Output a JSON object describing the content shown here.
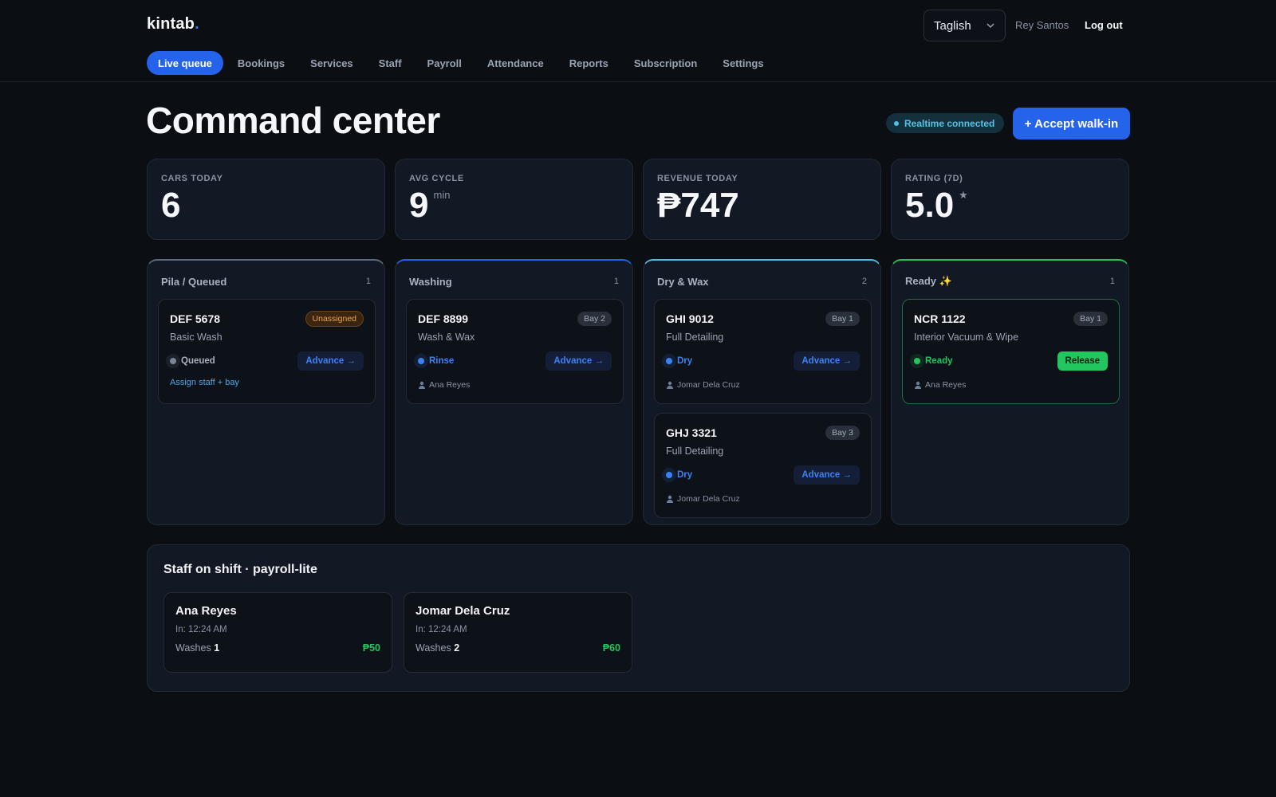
{
  "app": {
    "brand": "kintab",
    "brand_dot": "."
  },
  "header": {
    "language": "Taglish",
    "user_name": "Rey Santos",
    "logout_label": "Log out"
  },
  "nav": {
    "items": [
      {
        "label": "Live queue",
        "active": true
      },
      {
        "label": "Bookings"
      },
      {
        "label": "Services"
      },
      {
        "label": "Staff"
      },
      {
        "label": "Payroll"
      },
      {
        "label": "Attendance"
      },
      {
        "label": "Reports"
      },
      {
        "label": "Subscription"
      },
      {
        "label": "Settings"
      }
    ]
  },
  "page": {
    "title": "Command center",
    "realtime_label": "Realtime connected",
    "walkin_label": "+ Accept walk-in"
  },
  "stats": [
    {
      "label": "CARS TODAY",
      "value": "6",
      "suffix": ""
    },
    {
      "label": "AVG CYCLE",
      "value": "9",
      "suffix": "min"
    },
    {
      "label": "REVENUE TODAY",
      "value": "₱747",
      "suffix": ""
    },
    {
      "label": "RATING (7D)",
      "value": "5.0",
      "suffix": "★"
    }
  ],
  "columns": [
    {
      "title": "Pila / Queued",
      "count": "1",
      "accent": "#5a6b82",
      "cards": [
        {
          "plate": "DEF 5678",
          "badge": "Unassigned",
          "service": "Basic Wash",
          "status": "Queued",
          "status_color": "#7c8594",
          "action": "Advance →",
          "link": "Assign staff + bay"
        }
      ]
    },
    {
      "title": "Washing",
      "count": "1",
      "accent": "#2563eb",
      "cards": [
        {
          "plate": "DEF 8899",
          "badge": "Bay 2",
          "service": "Wash & Wax",
          "status": "Rinse",
          "status_color": "#3b82f6",
          "action": "Advance →",
          "assignee": "Ana Reyes"
        }
      ]
    },
    {
      "title": "Dry & Wax",
      "count": "2",
      "accent": "#4fc3e8",
      "cards": [
        {
          "plate": "GHI 9012",
          "badge": "Bay 1",
          "service": "Full Detailing",
          "status": "Dry",
          "status_color": "#3b82f6",
          "action": "Advance →",
          "assignee": "Jomar Dela Cruz"
        },
        {
          "plate": "GHJ 3321",
          "badge": "Bay 3",
          "service": "Full Detailing",
          "status": "Dry",
          "status_color": "#3b82f6",
          "action": "Advance →",
          "assignee": "Jomar Dela Cruz"
        }
      ]
    },
    {
      "title": "Ready ✨",
      "count": "1",
      "accent": "#22c55e",
      "cards": [
        {
          "plate": "NCR 1122",
          "badge": "Bay 1",
          "service": "Interior Vacuum & Wipe",
          "status": "Ready",
          "status_color": "#22c55e",
          "release": "Release",
          "assignee": "Ana Reyes"
        }
      ]
    }
  ],
  "staff": {
    "title": "Staff on shift · payroll-lite",
    "members": [
      {
        "name": "Ana Reyes",
        "clock_in": "In: 12:24 AM",
        "washes_label": "Washes",
        "washes": "1",
        "pay": "₱50"
      },
      {
        "name": "Jomar Dela Cruz",
        "clock_in": "In: 12:24 AM",
        "washes_label": "Washes",
        "washes": "2",
        "pay": "₱60"
      }
    ]
  }
}
